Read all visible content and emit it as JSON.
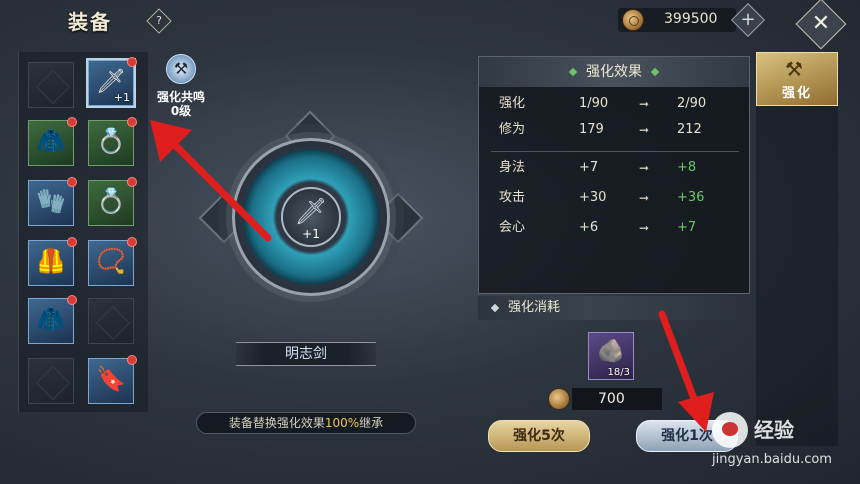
{
  "header": {
    "title": "装备",
    "help_label": "?",
    "currency_value": "399500",
    "plus_label": "+",
    "close_label": "✕"
  },
  "grid": {
    "slots": [
      {
        "glyph": "",
        "level": "",
        "dot": false
      },
      {
        "glyph": "🗡",
        "level": "+1",
        "dot": true
      },
      {
        "glyph": "🧥",
        "level": "",
        "dot": true
      },
      {
        "glyph": "💍",
        "level": "",
        "dot": true
      },
      {
        "glyph": "🧤",
        "level": "",
        "dot": true
      },
      {
        "glyph": "💍",
        "level": "",
        "dot": true
      },
      {
        "glyph": "🦺",
        "level": "",
        "dot": true
      },
      {
        "glyph": "📿",
        "level": "",
        "dot": true
      },
      {
        "glyph": "🧥",
        "level": "",
        "dot": true
      },
      {
        "glyph": "",
        "level": "",
        "dot": false
      },
      {
        "glyph": "",
        "level": "",
        "dot": false
      },
      {
        "glyph": "🔖",
        "level": "",
        "dot": true
      }
    ]
  },
  "resonance": {
    "title": "强化共鸣",
    "level": "0级",
    "icon": "anvil-icon"
  },
  "dial": {
    "level": "+1",
    "icon": "sword-icon"
  },
  "item_name": "明志剑",
  "inherit_note": {
    "prefix": "装备替换强化效果",
    "percent": "100%",
    "suffix": "继承"
  },
  "effect": {
    "header": "强化效果",
    "rows": [
      {
        "label": "强化",
        "from": "1/90",
        "to": "2/90",
        "green": false
      },
      {
        "label": "修为",
        "from": "179",
        "to": "212",
        "green": false
      },
      {
        "label": "身法",
        "from": "+7",
        "to": "+8",
        "green": true
      },
      {
        "label": "攻击",
        "from": "+30",
        "to": "+36",
        "green": true
      },
      {
        "label": "会心",
        "from": "+6",
        "to": "+7",
        "green": true
      }
    ],
    "arrow_symbol": "➞"
  },
  "cost": {
    "header": "强化消耗",
    "material_count": "18/3",
    "coin_value": "700"
  },
  "buttons": {
    "strengthen_5": "强化5次",
    "strengthen_1": "强化1次"
  },
  "tab": {
    "label": "强化"
  },
  "watermark": {
    "text": "经验",
    "url": "jingyan.baidu.com"
  },
  "colors": {
    "accent_gold": "#f0c65a",
    "stat_green": "#6ec46a",
    "badge_red": "#d93a35",
    "arrow_red": "#e01e1e"
  }
}
